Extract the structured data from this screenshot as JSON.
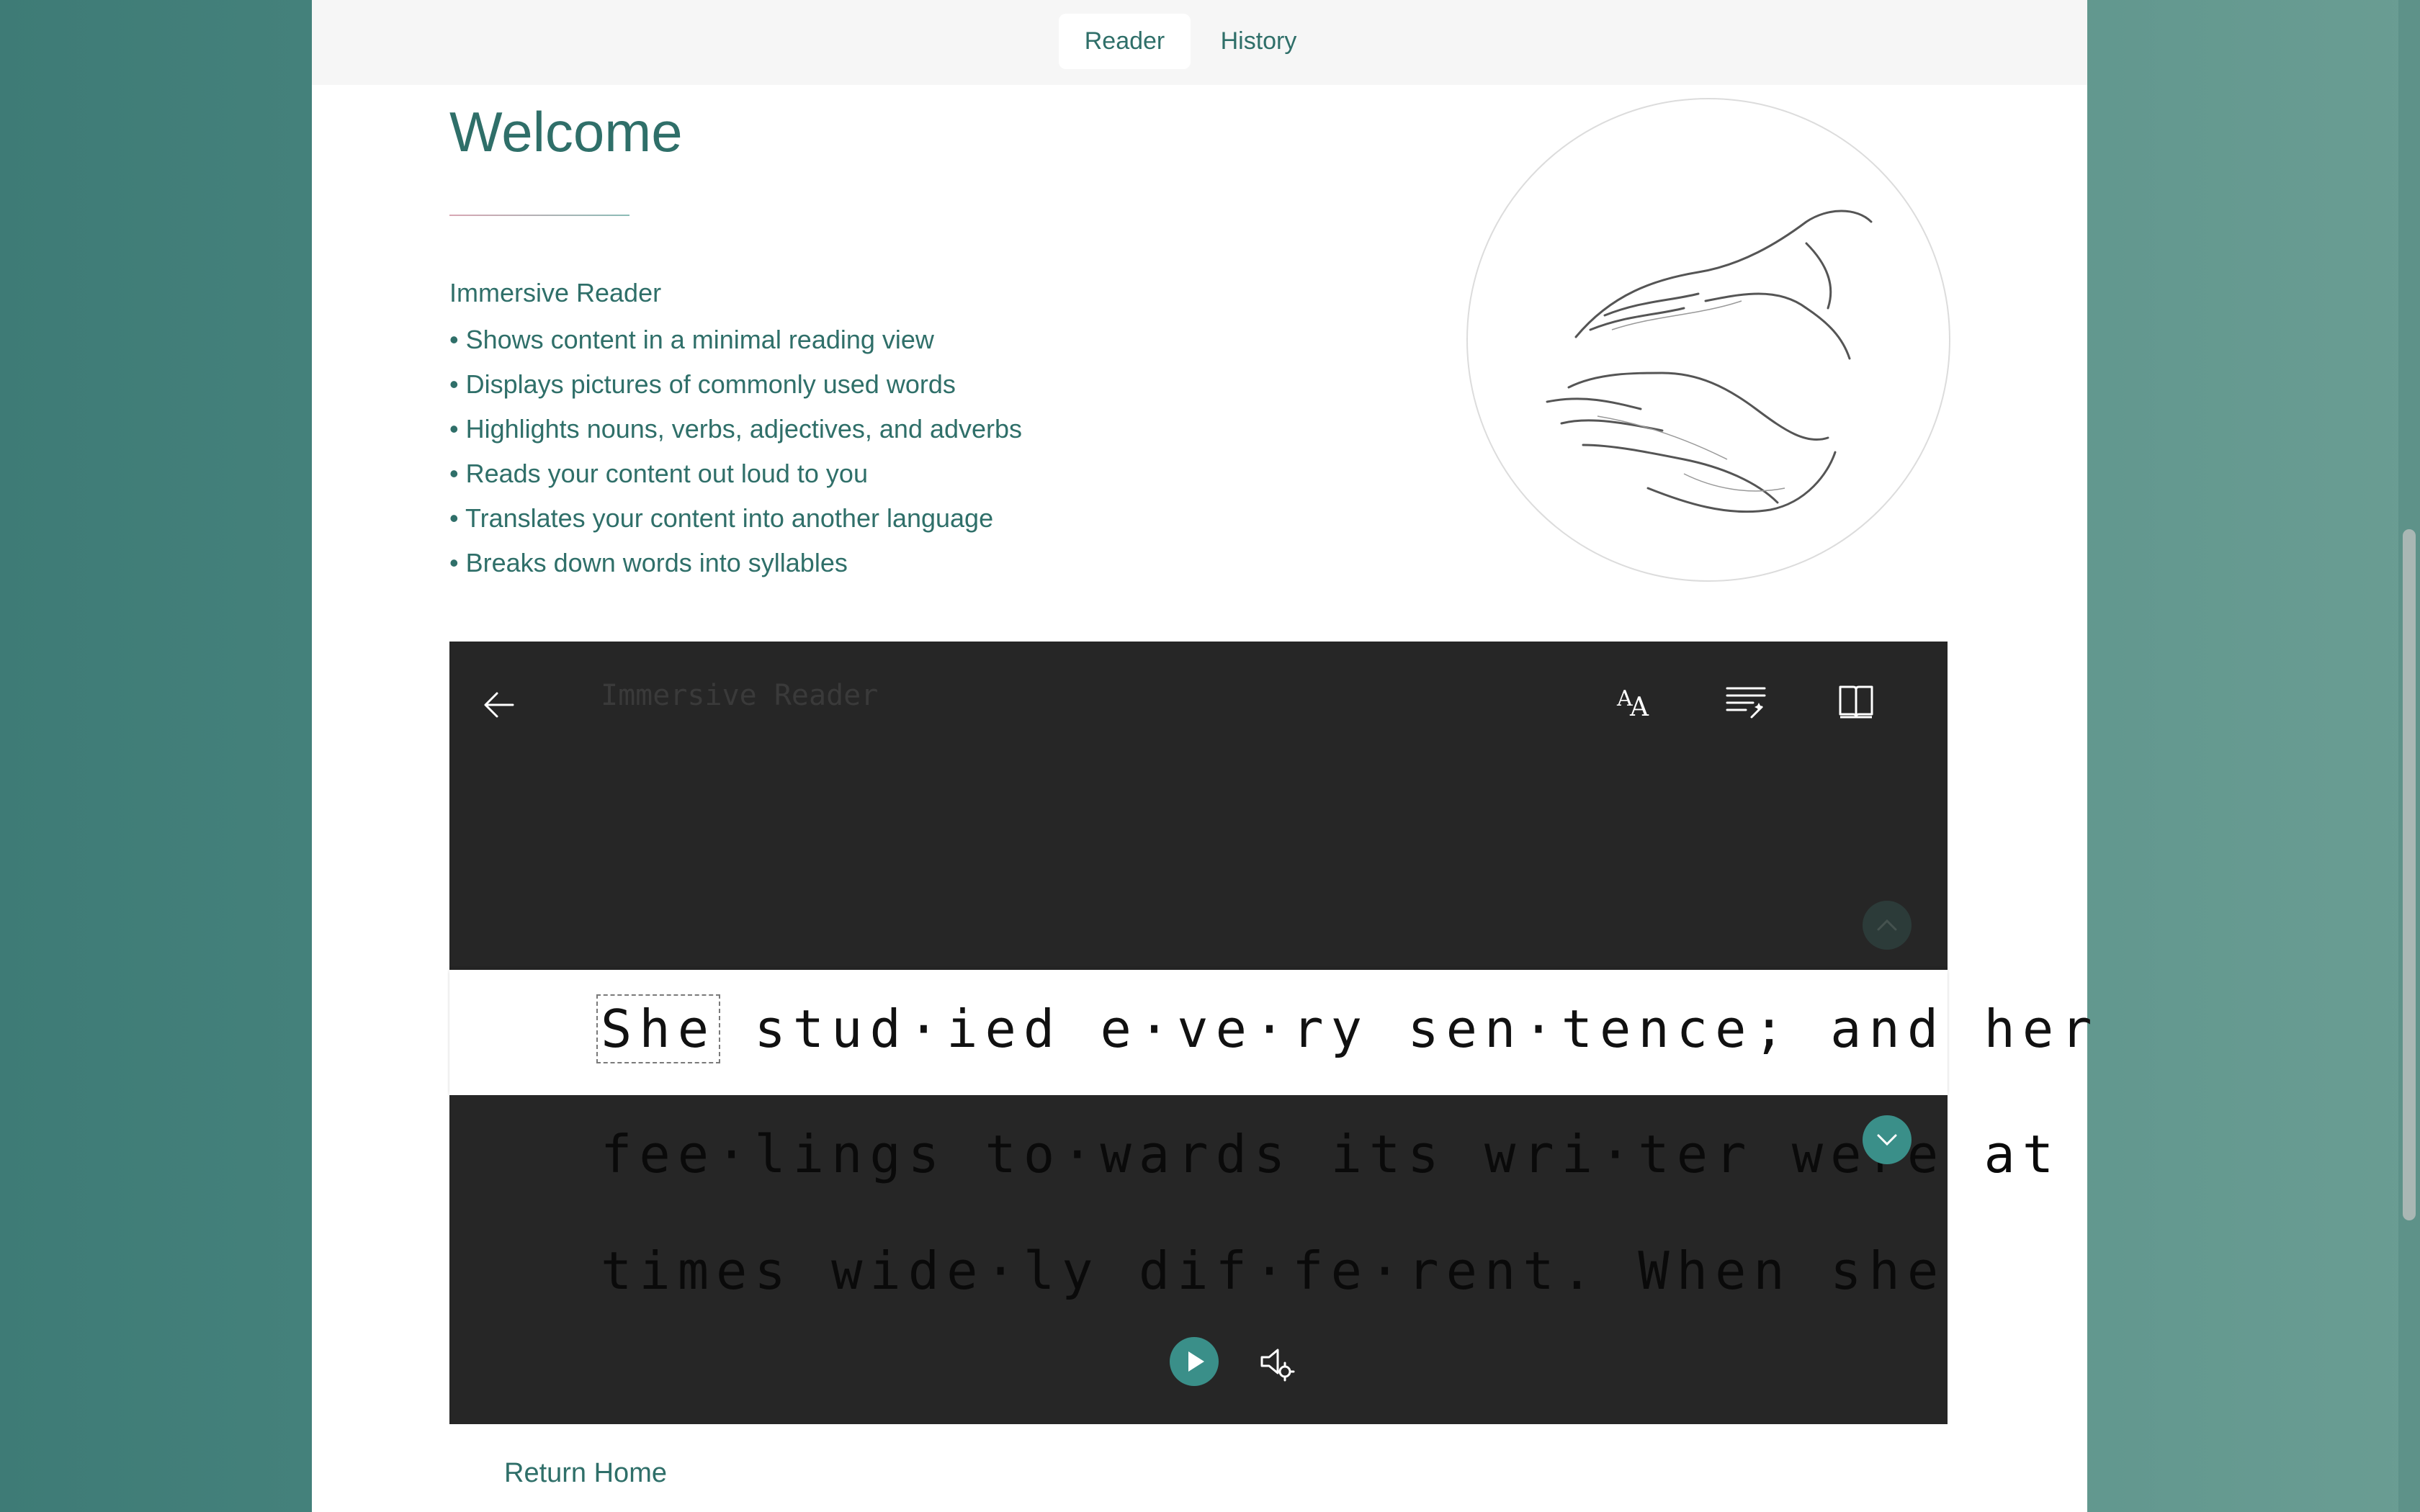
{
  "nav": {
    "tabs": [
      {
        "label": "Reader",
        "active": true
      },
      {
        "label": "History",
        "active": false
      }
    ]
  },
  "welcome": {
    "title": "Welcome",
    "intro_heading": "Immersive Reader",
    "features": [
      "• Shows content in a minimal reading view",
      "• Displays pictures of commonly used words",
      "• Highlights nouns, verbs, adjectives, and adverbs",
      "• Reads your content out loud to you",
      "• Translates your content into another language",
      "• Breaks down words into syllables"
    ],
    "illustration_icon": "sketched-hands-illustration"
  },
  "reader": {
    "title": "Immersive Reader",
    "toolbar_icons": [
      "back-arrow-icon",
      "text-preferences-icon",
      "grammar-options-icon",
      "reading-preferences-icon"
    ],
    "focus_word": "She",
    "active_line_rest": "stud·ied e·ve·ry sen·tence; and her",
    "next_lines": [
      "fee·lings to·wards its wri·ter were at",
      "times wide·ly dif·fe·rent. When she"
    ],
    "controls": [
      "play-icon",
      "voice-settings-icon"
    ]
  },
  "footer": {
    "return_home": "Return Home"
  },
  "colors": {
    "accent": "#3a8f89",
    "text_teal": "#2f6f69",
    "reader_bg": "#262626"
  }
}
